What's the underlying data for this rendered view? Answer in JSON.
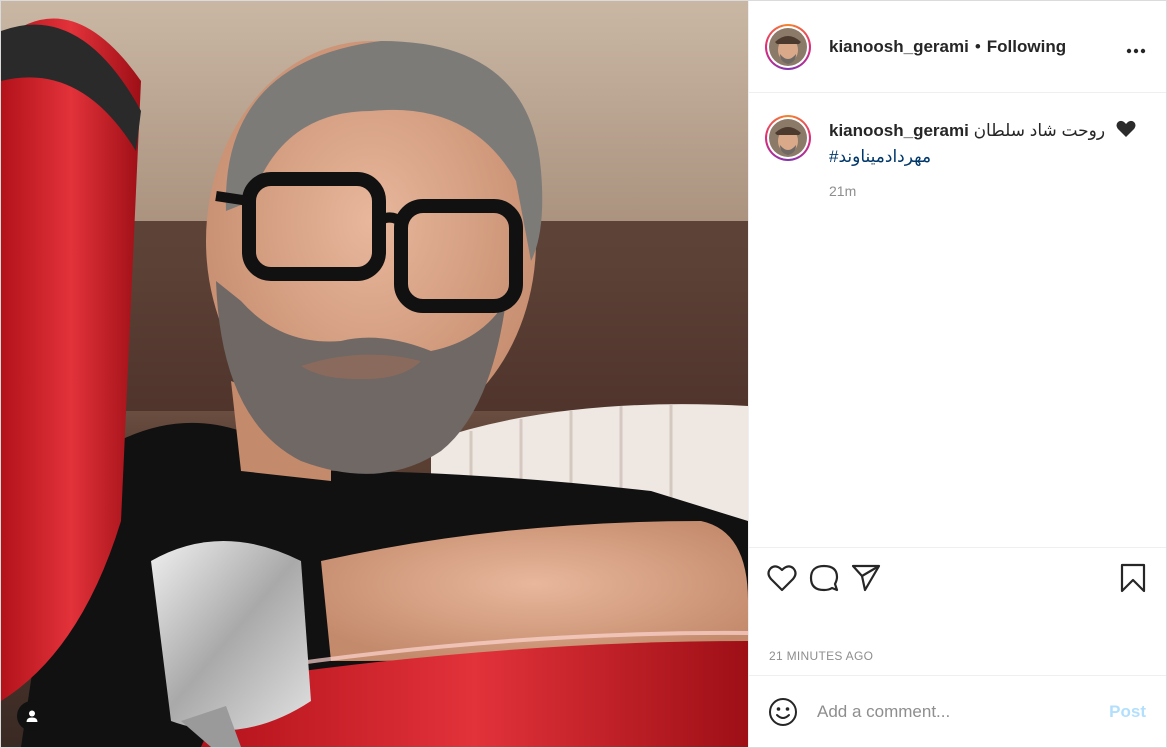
{
  "post": {
    "author": {
      "username": "kianoosh_gerami",
      "follow_separator": "•",
      "follow_status": "Following"
    },
    "more_icon": "more-horizontal-icon",
    "caption": {
      "username": "kianoosh_gerami",
      "text": "روحت شاد سلطان",
      "emoji": "black-heart-icon",
      "hashtag": "#مهردادمیناوند",
      "relative_time": "21m"
    },
    "actions": {
      "like_icon": "heart-icon",
      "comment_icon": "comment-icon",
      "share_icon": "paper-plane-icon",
      "save_icon": "bookmark-icon"
    },
    "timestamp": "21 MINUTES AGO",
    "comment_input": {
      "placeholder": "Add a comment...",
      "emoji_icon": "smiley-icon",
      "post_label": "Post"
    },
    "photo": {
      "tag_icon": "user-tag-icon"
    }
  },
  "colors": {
    "text": "#262626",
    "muted": "#8e8e8e",
    "link": "#00376b",
    "post_disabled": "#b2dffc",
    "border": "#efefef"
  }
}
